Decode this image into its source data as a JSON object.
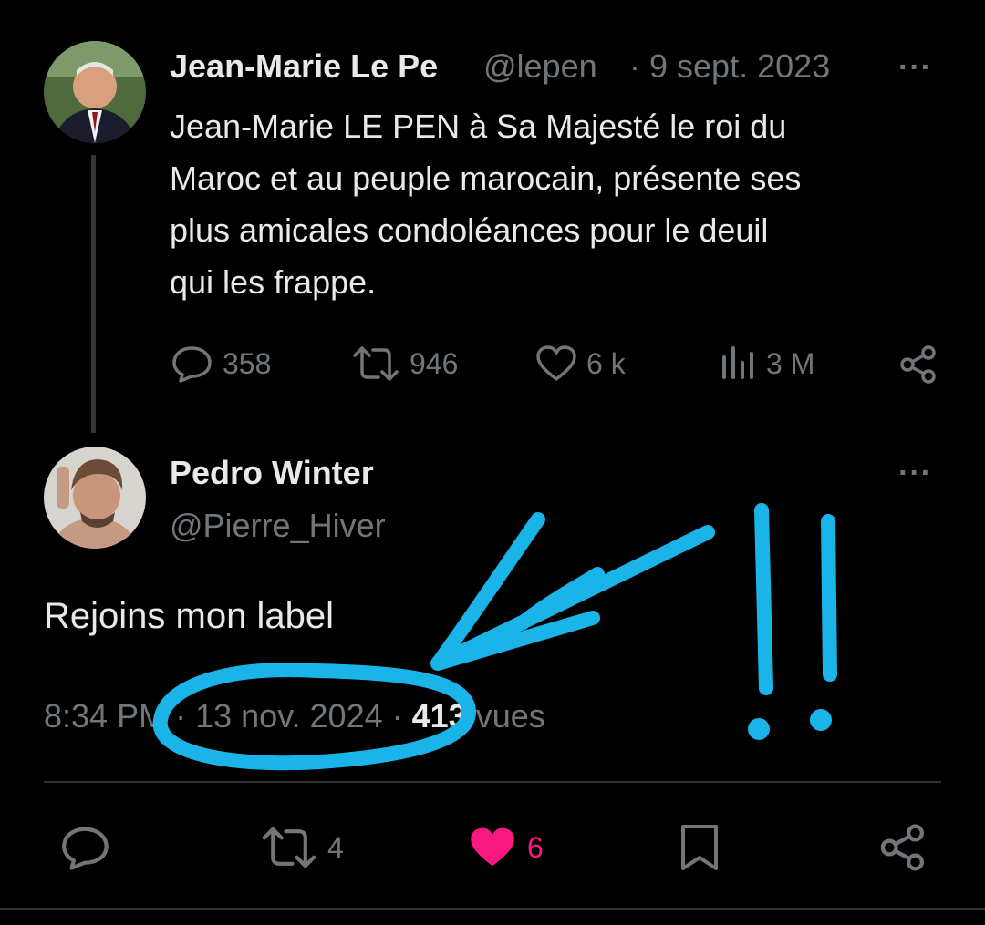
{
  "colors": {
    "accent": "#1ab4e8",
    "like": "#f91880",
    "muted": "#71767b",
    "text": "#e7e9ea",
    "divider": "#2f3336"
  },
  "tweet1": {
    "author_name": "Jean-Marie Le Pe",
    "handle": "@lepen",
    "separator": "·",
    "date": "9 sept. 2023",
    "more": "···",
    "text_lines": [
      "Jean-Marie LE PEN à Sa Majesté le roi du",
      "Maroc et au peuple marocain, présente ses",
      "plus amicales condoléances pour le deuil",
      "qui les frappe."
    ],
    "actions": {
      "replies": "358",
      "reposts": "946",
      "likes": "6 k",
      "views": "3 M"
    },
    "icons": [
      "reply-icon",
      "repost-icon",
      "like-icon",
      "views-icon",
      "share-icon"
    ]
  },
  "tweet2": {
    "author_name": "Pedro Winter",
    "handle": "@Pierre_Hiver",
    "more": "···",
    "text": "Rejoins mon label",
    "time": "8:34 PM",
    "date": "13 nov. 2024",
    "views_count": "413",
    "views_label": "vues",
    "actions": {
      "reposts": "4",
      "likes": "6"
    },
    "icons": [
      "reply-icon",
      "repost-icon",
      "like-filled-icon",
      "bookmark-icon",
      "share-icon"
    ]
  },
  "annotation": {
    "marks": "!!",
    "color": "#1ab4e8"
  }
}
